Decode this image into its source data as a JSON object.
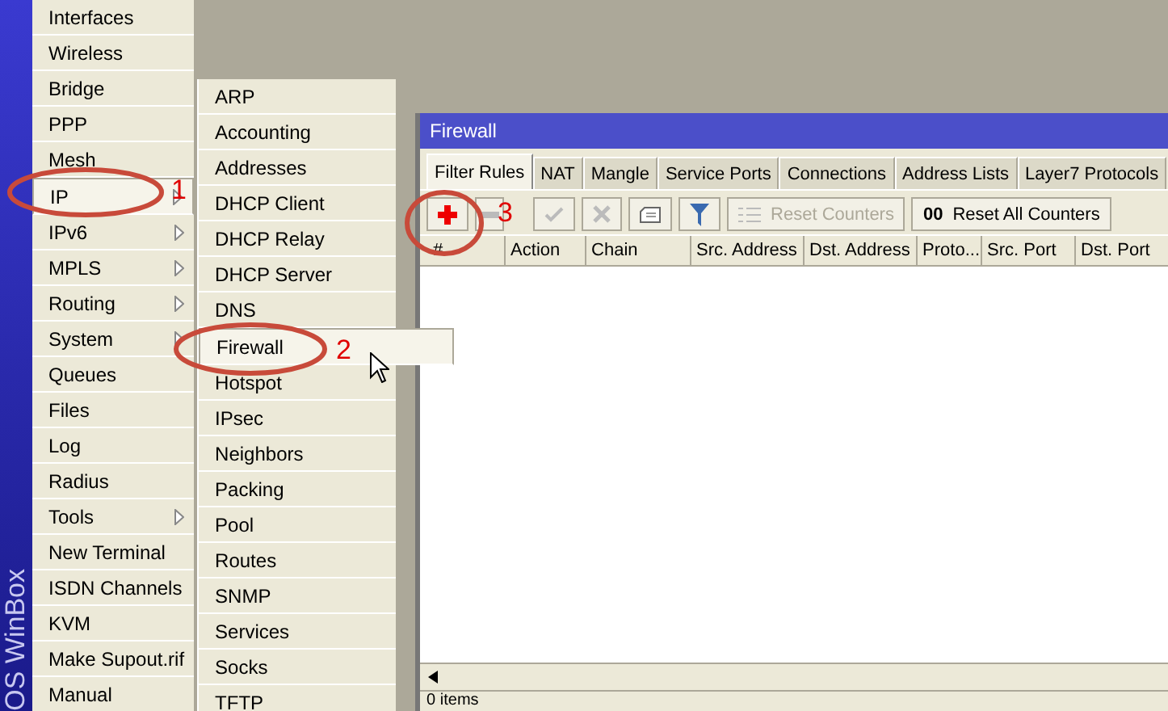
{
  "brand": "OS WinBox",
  "main_menu": [
    {
      "label": "Interfaces",
      "submenu": false,
      "selected": false
    },
    {
      "label": "Wireless",
      "submenu": false,
      "selected": false
    },
    {
      "label": "Bridge",
      "submenu": false,
      "selected": false
    },
    {
      "label": "PPP",
      "submenu": false,
      "selected": false
    },
    {
      "label": "Mesh",
      "submenu": false,
      "selected": false
    },
    {
      "label": "IP",
      "submenu": true,
      "selected": true
    },
    {
      "label": "IPv6",
      "submenu": true,
      "selected": false
    },
    {
      "label": "MPLS",
      "submenu": true,
      "selected": false
    },
    {
      "label": "Routing",
      "submenu": true,
      "selected": false
    },
    {
      "label": "System",
      "submenu": true,
      "selected": false
    },
    {
      "label": "Queues",
      "submenu": false,
      "selected": false
    },
    {
      "label": "Files",
      "submenu": false,
      "selected": false
    },
    {
      "label": "Log",
      "submenu": false,
      "selected": false
    },
    {
      "label": "Radius",
      "submenu": false,
      "selected": false
    },
    {
      "label": "Tools",
      "submenu": true,
      "selected": false
    },
    {
      "label": "New Terminal",
      "submenu": false,
      "selected": false
    },
    {
      "label": "ISDN Channels",
      "submenu": false,
      "selected": false
    },
    {
      "label": "KVM",
      "submenu": false,
      "selected": false
    },
    {
      "label": "Make Supout.rif",
      "submenu": false,
      "selected": false
    },
    {
      "label": "Manual",
      "submenu": false,
      "selected": false
    }
  ],
  "ip_submenu": [
    {
      "label": "ARP",
      "selected": false
    },
    {
      "label": "Accounting",
      "selected": false
    },
    {
      "label": "Addresses",
      "selected": false
    },
    {
      "label": "DHCP Client",
      "selected": false
    },
    {
      "label": "DHCP Relay",
      "selected": false
    },
    {
      "label": "DHCP Server",
      "selected": false
    },
    {
      "label": "DNS",
      "selected": false
    },
    {
      "label": "Firewall",
      "selected": true
    },
    {
      "label": "Hotspot",
      "selected": false
    },
    {
      "label": "IPsec",
      "selected": false
    },
    {
      "label": "Neighbors",
      "selected": false
    },
    {
      "label": "Packing",
      "selected": false
    },
    {
      "label": "Pool",
      "selected": false
    },
    {
      "label": "Routes",
      "selected": false
    },
    {
      "label": "SNMP",
      "selected": false
    },
    {
      "label": "Services",
      "selected": false
    },
    {
      "label": "Socks",
      "selected": false
    },
    {
      "label": "TFTP",
      "selected": false
    }
  ],
  "window": {
    "title": "Firewall",
    "tabs": [
      {
        "label": "Filter Rules",
        "selected": true
      },
      {
        "label": "NAT",
        "selected": false
      },
      {
        "label": "Mangle",
        "selected": false
      },
      {
        "label": "Service Ports",
        "selected": false
      },
      {
        "label": "Connections",
        "selected": false
      },
      {
        "label": "Address Lists",
        "selected": false
      },
      {
        "label": "Layer7 Protocols",
        "selected": false
      }
    ],
    "toolbar": [
      {
        "kind": "add",
        "disabled": false
      },
      {
        "kind": "remove",
        "disabled": true
      },
      {
        "kind": "enable",
        "disabled": true
      },
      {
        "kind": "disable",
        "disabled": true
      },
      {
        "kind": "comment",
        "disabled": false
      },
      {
        "kind": "filter",
        "disabled": false
      },
      {
        "kind": "reset",
        "label": "Reset Counters",
        "disabled": true
      },
      {
        "kind": "reset_all",
        "label": "Reset All Counters",
        "icon_text": "00",
        "disabled": false
      }
    ],
    "columns": [
      "#",
      "Action",
      "Chain",
      "Src. Address",
      "Dst. Address",
      "Proto...",
      "Src. Port",
      "Dst. Port"
    ],
    "status": "0 items"
  },
  "annotations": [
    {
      "label": "1"
    },
    {
      "label": "2"
    },
    {
      "label": "3"
    }
  ]
}
